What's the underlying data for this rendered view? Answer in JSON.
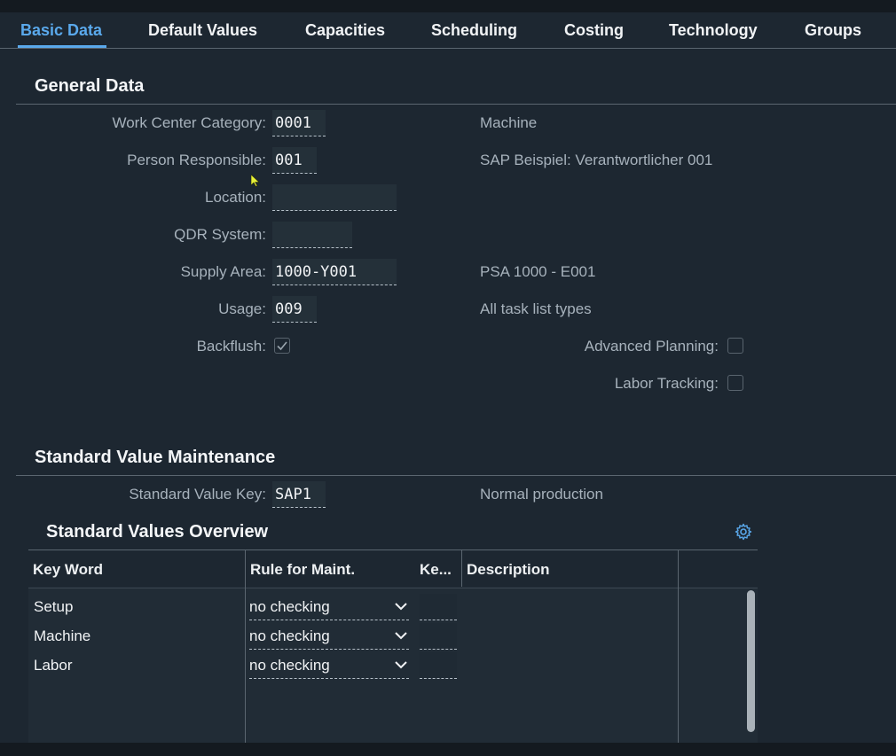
{
  "tabs": [
    "Basic Data",
    "Default Values",
    "Capacities",
    "Scheduling",
    "Costing",
    "Technology",
    "Groups"
  ],
  "general": {
    "title": "General Data",
    "work_center_category": {
      "label": "Work Center Category:",
      "value": "0001",
      "desc": "Machine"
    },
    "person_responsible": {
      "label": "Person Responsible:",
      "value": "001",
      "desc": "SAP Beispiel: Verantwortlicher 001"
    },
    "location": {
      "label": "Location:",
      "value": ""
    },
    "qdr_system": {
      "label": "QDR System:",
      "value": ""
    },
    "supply_area": {
      "label": "Supply Area:",
      "value": "1000-Y001",
      "desc": "PSA 1000 - E001"
    },
    "usage": {
      "label": "Usage:",
      "value": "009",
      "desc": "All task list types"
    },
    "backflush": {
      "label": "Backflush:",
      "checked": true
    },
    "advanced_planning": {
      "label": "Advanced Planning:",
      "checked": false
    },
    "labor_tracking": {
      "label": "Labor Tracking:",
      "checked": false
    }
  },
  "svm": {
    "title": "Standard Value Maintenance",
    "key": {
      "label": "Standard Value Key:",
      "value": "SAP1",
      "desc": "Normal production"
    }
  },
  "overview": {
    "title": "Standard Values Overview",
    "columns": [
      "Key Word",
      "Rule for Maint.",
      "Ke...",
      "Description"
    ],
    "rows": [
      {
        "keyword": "Setup",
        "rule": "no checking"
      },
      {
        "keyword": "Machine",
        "rule": "no checking"
      },
      {
        "keyword": "Labor",
        "rule": "no checking"
      }
    ]
  },
  "colors": {
    "accent": "#5aa9ec",
    "background": "#1d2731"
  }
}
